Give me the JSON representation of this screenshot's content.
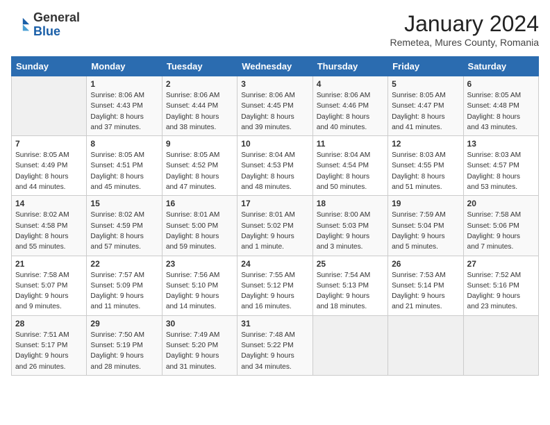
{
  "header": {
    "logo": {
      "line1": "General",
      "line2": "Blue"
    },
    "title": "January 2024",
    "subtitle": "Remetea, Mures County, Romania"
  },
  "days_of_week": [
    "Sunday",
    "Monday",
    "Tuesday",
    "Wednesday",
    "Thursday",
    "Friday",
    "Saturday"
  ],
  "weeks": [
    [
      {
        "day": "",
        "info": ""
      },
      {
        "day": "1",
        "info": "Sunrise: 8:06 AM\nSunset: 4:43 PM\nDaylight: 8 hours\nand 37 minutes."
      },
      {
        "day": "2",
        "info": "Sunrise: 8:06 AM\nSunset: 4:44 PM\nDaylight: 8 hours\nand 38 minutes."
      },
      {
        "day": "3",
        "info": "Sunrise: 8:06 AM\nSunset: 4:45 PM\nDaylight: 8 hours\nand 39 minutes."
      },
      {
        "day": "4",
        "info": "Sunrise: 8:06 AM\nSunset: 4:46 PM\nDaylight: 8 hours\nand 40 minutes."
      },
      {
        "day": "5",
        "info": "Sunrise: 8:05 AM\nSunset: 4:47 PM\nDaylight: 8 hours\nand 41 minutes."
      },
      {
        "day": "6",
        "info": "Sunrise: 8:05 AM\nSunset: 4:48 PM\nDaylight: 8 hours\nand 43 minutes."
      }
    ],
    [
      {
        "day": "7",
        "info": "Sunrise: 8:05 AM\nSunset: 4:49 PM\nDaylight: 8 hours\nand 44 minutes."
      },
      {
        "day": "8",
        "info": "Sunrise: 8:05 AM\nSunset: 4:51 PM\nDaylight: 8 hours\nand 45 minutes."
      },
      {
        "day": "9",
        "info": "Sunrise: 8:05 AM\nSunset: 4:52 PM\nDaylight: 8 hours\nand 47 minutes."
      },
      {
        "day": "10",
        "info": "Sunrise: 8:04 AM\nSunset: 4:53 PM\nDaylight: 8 hours\nand 48 minutes."
      },
      {
        "day": "11",
        "info": "Sunrise: 8:04 AM\nSunset: 4:54 PM\nDaylight: 8 hours\nand 50 minutes."
      },
      {
        "day": "12",
        "info": "Sunrise: 8:03 AM\nSunset: 4:55 PM\nDaylight: 8 hours\nand 51 minutes."
      },
      {
        "day": "13",
        "info": "Sunrise: 8:03 AM\nSunset: 4:57 PM\nDaylight: 8 hours\nand 53 minutes."
      }
    ],
    [
      {
        "day": "14",
        "info": "Sunrise: 8:02 AM\nSunset: 4:58 PM\nDaylight: 8 hours\nand 55 minutes."
      },
      {
        "day": "15",
        "info": "Sunrise: 8:02 AM\nSunset: 4:59 PM\nDaylight: 8 hours\nand 57 minutes."
      },
      {
        "day": "16",
        "info": "Sunrise: 8:01 AM\nSunset: 5:00 PM\nDaylight: 8 hours\nand 59 minutes."
      },
      {
        "day": "17",
        "info": "Sunrise: 8:01 AM\nSunset: 5:02 PM\nDaylight: 9 hours\nand 1 minute."
      },
      {
        "day": "18",
        "info": "Sunrise: 8:00 AM\nSunset: 5:03 PM\nDaylight: 9 hours\nand 3 minutes."
      },
      {
        "day": "19",
        "info": "Sunrise: 7:59 AM\nSunset: 5:04 PM\nDaylight: 9 hours\nand 5 minutes."
      },
      {
        "day": "20",
        "info": "Sunrise: 7:58 AM\nSunset: 5:06 PM\nDaylight: 9 hours\nand 7 minutes."
      }
    ],
    [
      {
        "day": "21",
        "info": "Sunrise: 7:58 AM\nSunset: 5:07 PM\nDaylight: 9 hours\nand 9 minutes."
      },
      {
        "day": "22",
        "info": "Sunrise: 7:57 AM\nSunset: 5:09 PM\nDaylight: 9 hours\nand 11 minutes."
      },
      {
        "day": "23",
        "info": "Sunrise: 7:56 AM\nSunset: 5:10 PM\nDaylight: 9 hours\nand 14 minutes."
      },
      {
        "day": "24",
        "info": "Sunrise: 7:55 AM\nSunset: 5:12 PM\nDaylight: 9 hours\nand 16 minutes."
      },
      {
        "day": "25",
        "info": "Sunrise: 7:54 AM\nSunset: 5:13 PM\nDaylight: 9 hours\nand 18 minutes."
      },
      {
        "day": "26",
        "info": "Sunrise: 7:53 AM\nSunset: 5:14 PM\nDaylight: 9 hours\nand 21 minutes."
      },
      {
        "day": "27",
        "info": "Sunrise: 7:52 AM\nSunset: 5:16 PM\nDaylight: 9 hours\nand 23 minutes."
      }
    ],
    [
      {
        "day": "28",
        "info": "Sunrise: 7:51 AM\nSunset: 5:17 PM\nDaylight: 9 hours\nand 26 minutes."
      },
      {
        "day": "29",
        "info": "Sunrise: 7:50 AM\nSunset: 5:19 PM\nDaylight: 9 hours\nand 28 minutes."
      },
      {
        "day": "30",
        "info": "Sunrise: 7:49 AM\nSunset: 5:20 PM\nDaylight: 9 hours\nand 31 minutes."
      },
      {
        "day": "31",
        "info": "Sunrise: 7:48 AM\nSunset: 5:22 PM\nDaylight: 9 hours\nand 34 minutes."
      },
      {
        "day": "",
        "info": ""
      },
      {
        "day": "",
        "info": ""
      },
      {
        "day": "",
        "info": ""
      }
    ]
  ]
}
